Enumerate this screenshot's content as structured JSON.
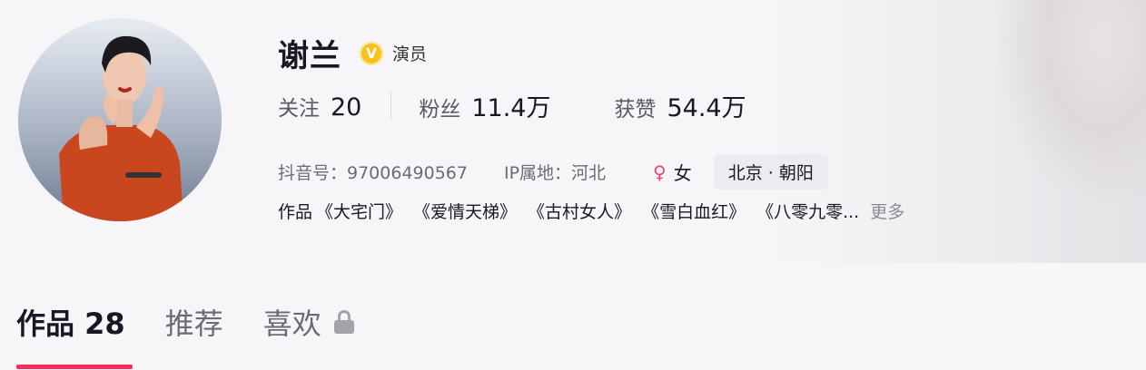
{
  "profile": {
    "name": "谢兰",
    "verified_badge": "V",
    "verification_label": "演员",
    "stats": [
      {
        "label": "关注",
        "value": "20"
      },
      {
        "label": "粉丝",
        "value": "11.4万"
      },
      {
        "label": "获赞",
        "value": "54.4万"
      }
    ],
    "douyin_id": "抖音号：97006490567",
    "ip_location": "IP属地：河北",
    "gender_icon": "♀",
    "gender": "女",
    "location_tag": "北京 · 朝阳",
    "works_prefix": "作品",
    "works": [
      "《大宅门》",
      "《爱情天梯》",
      "《古村女人》",
      "《雪白血红》",
      "《八零九零..."
    ],
    "works_more": "更多"
  },
  "tabs": [
    {
      "label": "作品 28",
      "active": true
    },
    {
      "label": "推荐",
      "active": false
    },
    {
      "label": "喜欢",
      "active": false,
      "locked": true
    }
  ],
  "colors": {
    "accent": "#fe2c55",
    "badge": "#f7c21c",
    "gender": "#f0456a"
  }
}
